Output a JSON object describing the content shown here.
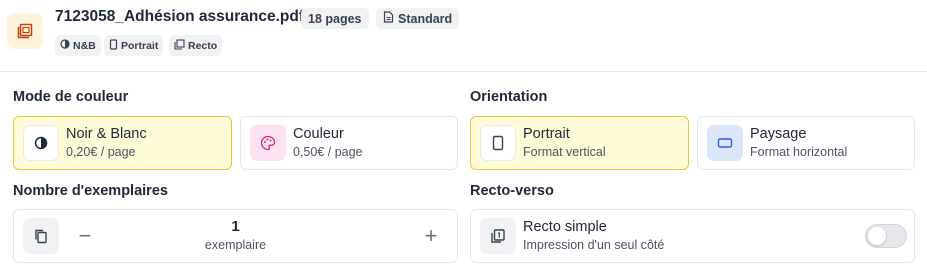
{
  "file": {
    "name": "7123058_Adhésion assurance.pdf",
    "pages": "18 pages",
    "quality": "Standard",
    "tags": [
      "N&B",
      "Portrait",
      "Recto"
    ]
  },
  "color_mode": {
    "title": "Mode de couleur",
    "options": [
      {
        "label": "Noir & Blanc",
        "price": "0,20€ / page",
        "selected": true
      },
      {
        "label": "Couleur",
        "price": "0,50€ / page",
        "selected": false
      }
    ]
  },
  "orientation": {
    "title": "Orientation",
    "options": [
      {
        "label": "Portrait",
        "desc": "Format vertical",
        "selected": true
      },
      {
        "label": "Paysage",
        "desc": "Format horizontal",
        "selected": false
      }
    ]
  },
  "copies": {
    "title": "Nombre d'exemplaires",
    "value": "1",
    "unit": "exemplaire",
    "minus": "−",
    "plus": "+"
  },
  "duplex": {
    "title": "Recto-verso",
    "label": "Recto simple",
    "desc": "Impression d'un seul côté",
    "enabled": false
  },
  "colors": {
    "selected_bg": "#fefbd8",
    "selected_border": "#f2c230",
    "file_icon_bg": "#fdf2dc",
    "file_icon": "#c2410c",
    "color_icon_bg": "#fde2f1",
    "color_icon": "#db2777",
    "landscape_icon_bg": "#dbe6fb",
    "landscape_icon": "#2563eb"
  },
  "icons": {
    "file": "printer-file-icon",
    "pages": "file-icon",
    "bw": "contrast-icon",
    "color": "palette-icon",
    "portrait": "portrait-icon",
    "landscape": "landscape-icon",
    "copies": "copy-icon",
    "duplex": "single-sided-icon"
  }
}
